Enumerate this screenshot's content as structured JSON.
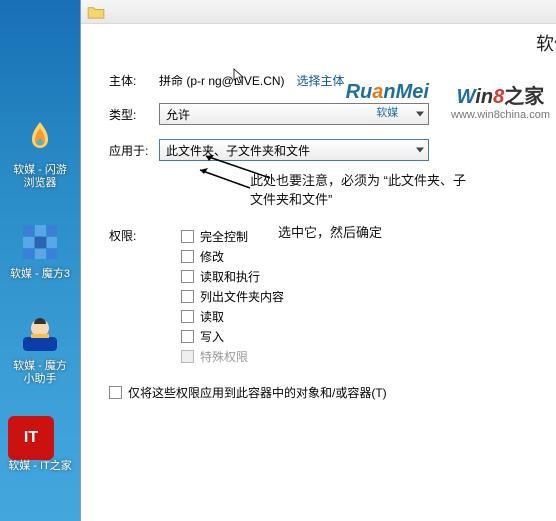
{
  "desktop": {
    "items": [
      {
        "label": "软媒 - 闪游浏览器"
      },
      {
        "label": "软媒 - 魔方3"
      },
      {
        "label": "软媒 - 魔方小助手"
      },
      {
        "label": "软媒 - IT之家"
      }
    ]
  },
  "explorer": {
    "title_fragment": "软件"
  },
  "dialog": {
    "principal_label": "主体:",
    "principal_value": "拼命 (p-r   ng@LIVE.CN)",
    "select_principal_link": "选择主体",
    "type_label": "类型:",
    "type_value": "允许",
    "apply_to_label": "应用于:",
    "apply_to_value": "此文件夹、子文件夹和文件",
    "perm_header": "权限:",
    "perms": {
      "full": "完全控制",
      "modify": "修改",
      "read_exec": "读取和执行",
      "list": "列出文件夹内容",
      "read": "读取",
      "write": "写入",
      "special": "特殊权限"
    },
    "apply_only": "仅将这些权限应用到此容器中的对象和/或容器(T)"
  },
  "annotations": {
    "note1": "此处也要注意，必须为 “此文件夹、子文件夹和文件”",
    "note2": "选中它，然后确定"
  },
  "watermark": {
    "ruanmei": "RuanMei",
    "ruanmei_sub": "软媒",
    "win8": "Win8之家",
    "win8_sub": "www.win8china.com"
  }
}
